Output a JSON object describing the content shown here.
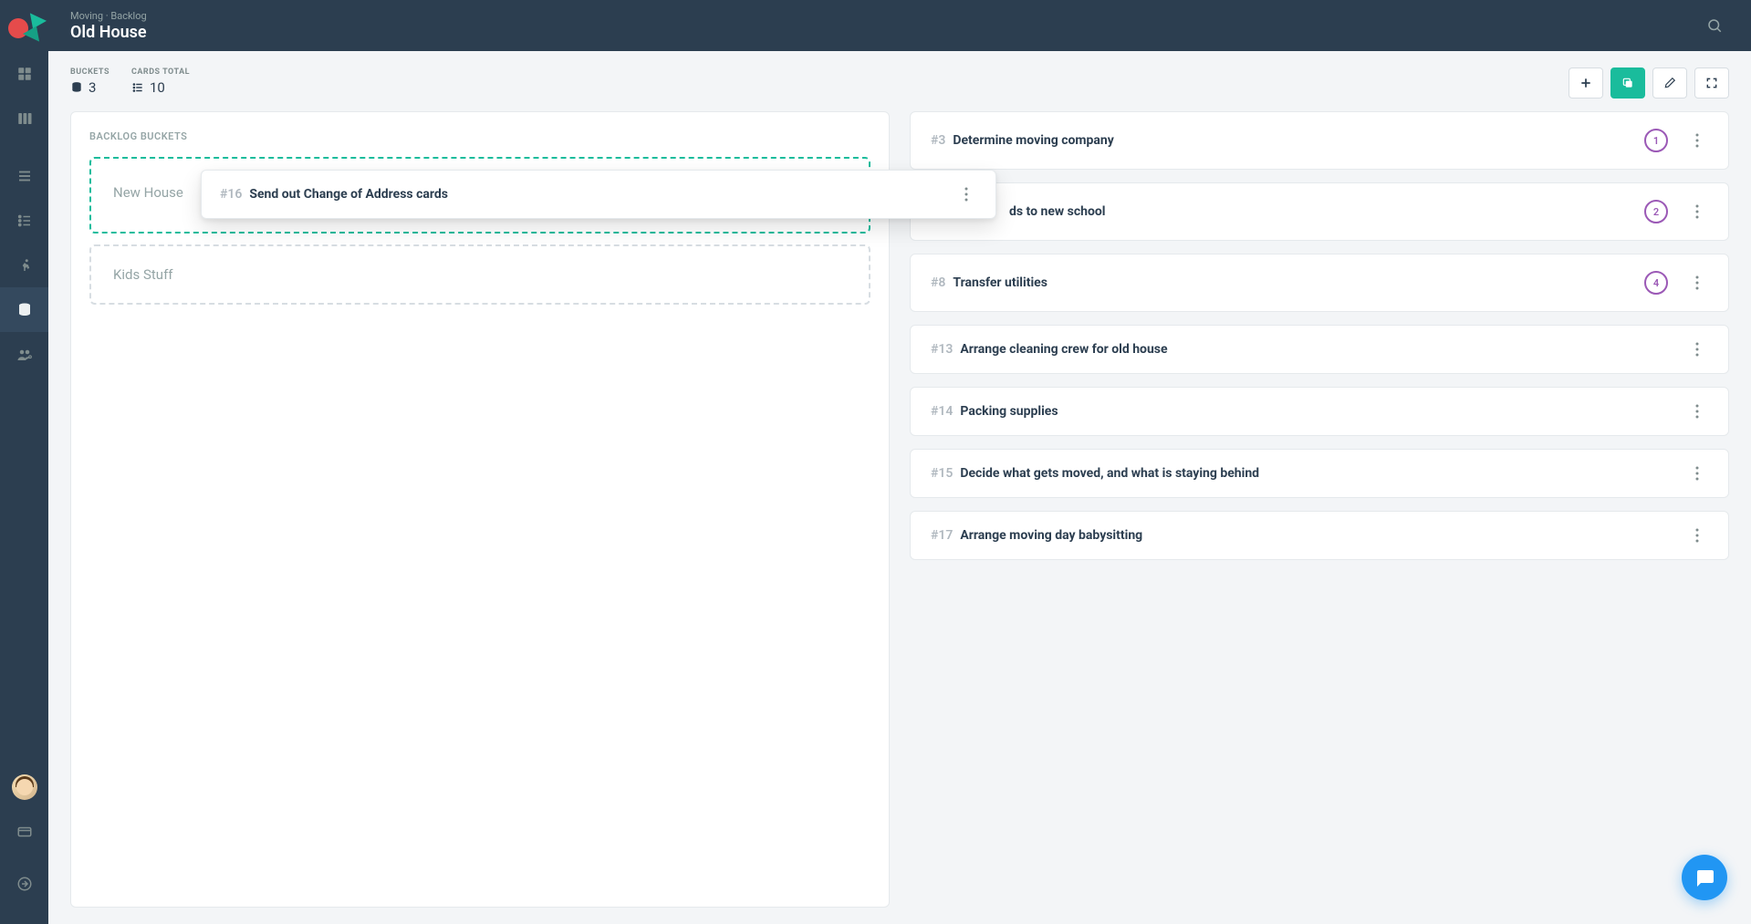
{
  "header": {
    "breadcrumb": "Moving · Backlog",
    "title": "Old House"
  },
  "stats": {
    "buckets_label": "BUCKETS",
    "buckets_value": "3",
    "cards_label": "CARDS TOTAL",
    "cards_value": "10"
  },
  "buckets_panel": {
    "title": "BACKLOG BUCKETS",
    "items": [
      {
        "name": "New House"
      },
      {
        "name": "Kids Stuff"
      }
    ]
  },
  "dragging_card": {
    "id": "#16",
    "title": "Send out Change of Address cards"
  },
  "cards": [
    {
      "id": "#3",
      "title": "Determine moving company",
      "badge": "1"
    },
    {
      "id": "",
      "title": "ds to new school",
      "badge": "2"
    },
    {
      "id": "#8",
      "title": "Transfer utilities",
      "badge": "4"
    },
    {
      "id": "#13",
      "title": "Arrange cleaning crew for old house",
      "badge": ""
    },
    {
      "id": "#14",
      "title": "Packing supplies",
      "badge": ""
    },
    {
      "id": "#15",
      "title": "Decide what gets moved, and what is staying behind",
      "badge": ""
    },
    {
      "id": "#17",
      "title": "Arrange moving day babysitting",
      "badge": ""
    }
  ],
  "colors": {
    "accent": "#1abc9c",
    "badge": "#9b59b6",
    "chat": "#2196f3"
  }
}
